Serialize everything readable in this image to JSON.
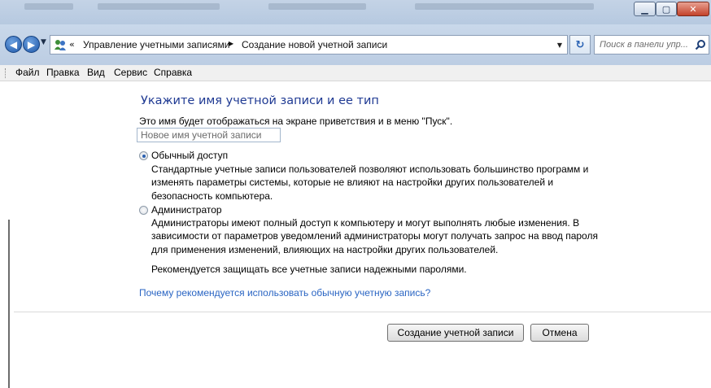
{
  "window": {
    "colors": {
      "accent": "#1f3a93",
      "link": "#2a65c3",
      "close": "#c3432b"
    }
  },
  "address_bar": {
    "back_icon": "back-arrow-icon",
    "forward_icon": "forward-arrow-icon",
    "chevron": "«",
    "breadcrumb": [
      "Управление учетными записями",
      "Создание новой учетной записи"
    ],
    "search_placeholder": "Поиск в панели упр..."
  },
  "menu": {
    "items": [
      "Файл",
      "Правка",
      "Вид",
      "Сервис",
      "Справка"
    ]
  },
  "main": {
    "heading": "Укажите имя учетной записи и ее тип",
    "info_text": "Это имя будет отображаться на экране приветствия и в меню \"Пуск\".",
    "name_input_placeholder": "Новое имя учетной записи",
    "options": [
      {
        "label": "Обычный доступ",
        "checked": true,
        "description": [
          "Стандартные учетные записи пользователей позволяют использовать большинство программ и",
          "изменять параметры системы, которые не влияют на настройки других пользователей и",
          "безопасность компьютера."
        ]
      },
      {
        "label": "Администратор",
        "checked": false,
        "description": [
          "Администраторы имеют полный доступ к компьютеру и могут выполнять любые изменения. В",
          "зависимости от параметров уведомлений администраторы могут получать запрос на ввод пароля",
          "для применения изменений, влияющих на настройки других пользователей."
        ]
      }
    ],
    "recommend_text": "Рекомендуется защищать все учетные записи надежными паролями.",
    "help_link": "Почему рекомендуется использовать обычную учетную запись?"
  },
  "buttons": {
    "create": "Создание учетной записи",
    "cancel": "Отмена"
  }
}
